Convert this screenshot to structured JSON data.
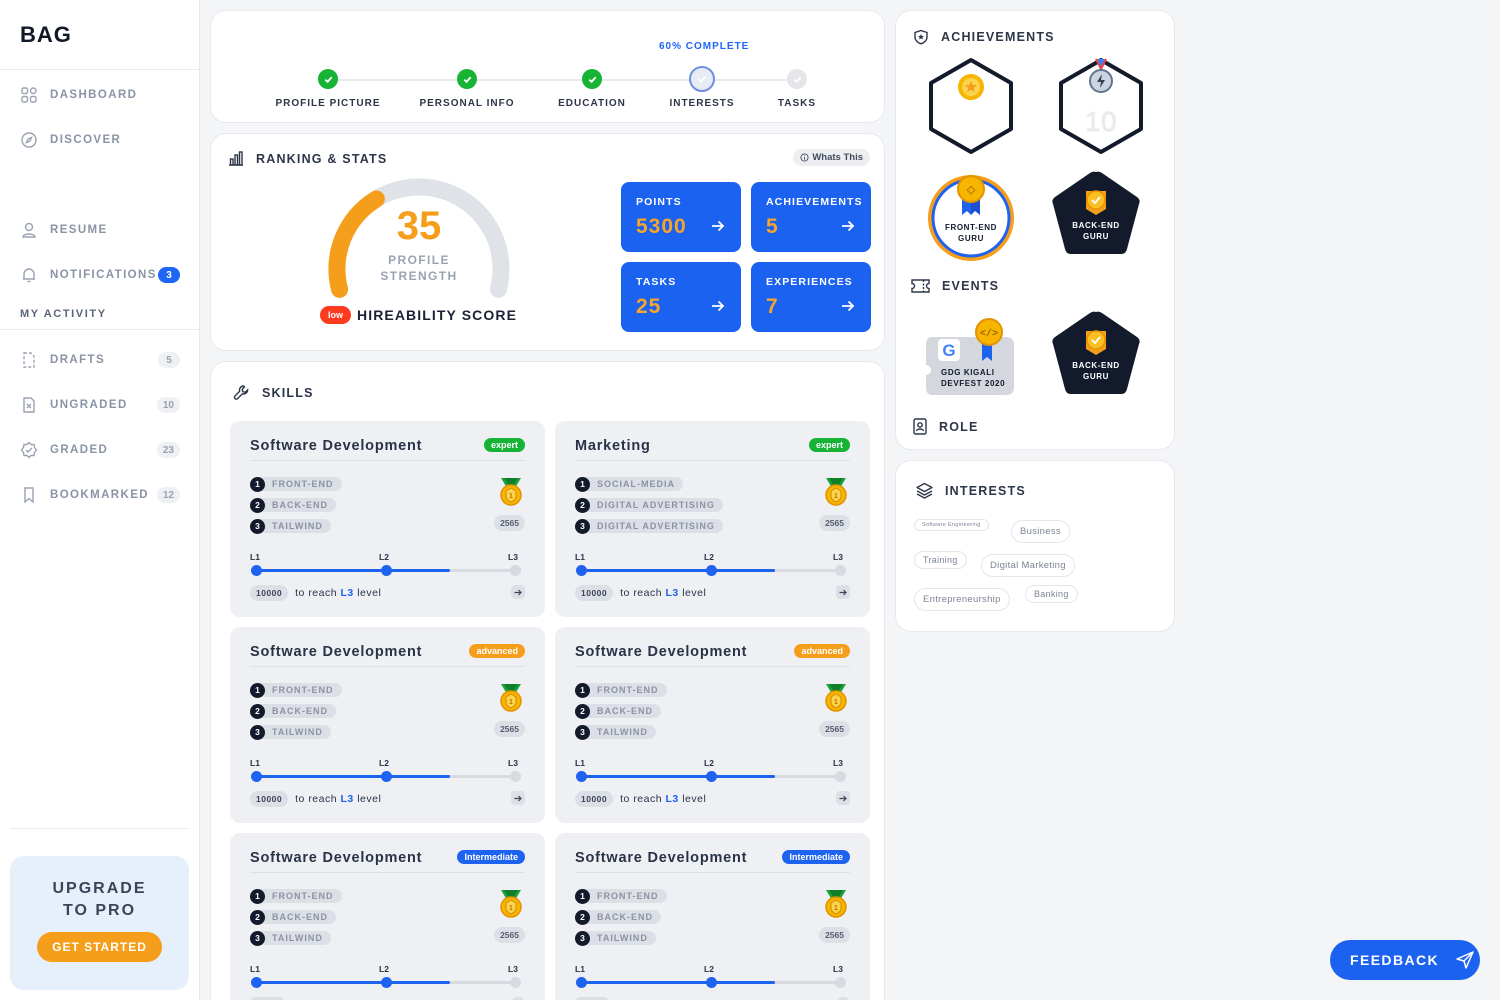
{
  "app": {
    "logo": "BAG"
  },
  "sidebar": {
    "items": [
      {
        "label": "DASHBOARD"
      },
      {
        "label": "DISCOVER"
      },
      {
        "label": "RESUME"
      },
      {
        "label": "NOTIFICATIONS",
        "count": "3"
      }
    ],
    "section_label": "MY ACTIVITY",
    "activity": [
      {
        "label": "DRAFTS",
        "count": "5"
      },
      {
        "label": "UNGRADED",
        "count": "10"
      },
      {
        "label": "GRADED",
        "count": "23"
      },
      {
        "label": "BOOKMARKED",
        "count": "12"
      }
    ],
    "upgrade": {
      "title_line1": "UPGRADE",
      "title_line2": "TO PRO",
      "button": "GET STARTED"
    }
  },
  "progress": {
    "label": "60% COMPLETE",
    "percent": 60,
    "steps": [
      {
        "label": "PROFILE PICTURE",
        "state": "done"
      },
      {
        "label": "PERSONAL INFO",
        "state": "done"
      },
      {
        "label": "EDUCATION",
        "state": "done"
      },
      {
        "label": "INTERESTS",
        "state": "current"
      },
      {
        "label": "TASKS",
        "state": "todo"
      }
    ]
  },
  "stats": {
    "title": "RANKING & STATS",
    "whats_this": "Whats This",
    "score": "35",
    "score_label_line1": "PROFILE",
    "score_label_line2": "STRENGTH",
    "gauge_fraction": 0.35,
    "hire_badge": "low",
    "hire_label": "HIREABILITY SCORE",
    "tiles": [
      {
        "label": "POINTS",
        "value": "5300"
      },
      {
        "label": "ACHIEVEMENTS",
        "value": "5"
      },
      {
        "label": "TASKS",
        "value": "25"
      },
      {
        "label": "EXPERIENCES",
        "value": "7"
      }
    ]
  },
  "skills": {
    "title": "SKILLS",
    "cards": [
      {
        "name": "Software Development",
        "level": "expert",
        "level_color": "#16b335",
        "items": [
          "FRONT-END",
          "BACK-END",
          "TAILWIND"
        ],
        "points": "2565",
        "levels": [
          "L1",
          "L2",
          "L3"
        ],
        "progress": 0.75,
        "reach_pts": "10000",
        "reach_text": "to reach",
        "reach_level": "L3",
        "reach_suffix": "level"
      },
      {
        "name": "Marketing",
        "level": "expert",
        "level_color": "#16b335",
        "items": [
          "SOCIAL-MEDIA",
          "DIGITAL ADVERTISING",
          "DIGITAL ADVERTISING"
        ],
        "points": "2565",
        "levels": [
          "L1",
          "L2",
          "L3"
        ],
        "progress": 0.75,
        "reach_pts": "10000",
        "reach_text": "to reach",
        "reach_level": "L3",
        "reach_suffix": "level"
      },
      {
        "name": "Software Development",
        "level": "advanced",
        "level_color": "#f59e1b",
        "items": [
          "FRONT-END",
          "BACK-END",
          "TAILWIND"
        ],
        "points": "2565",
        "levels": [
          "L1",
          "L2",
          "L3"
        ],
        "progress": 0.75,
        "reach_pts": "10000",
        "reach_text": "to reach",
        "reach_level": "L3",
        "reach_suffix": "level"
      },
      {
        "name": "Software Development",
        "level": "advanced",
        "level_color": "#f59e1b",
        "items": [
          "FRONT-END",
          "BACK-END",
          "TAILWIND"
        ],
        "points": "2565",
        "levels": [
          "L1",
          "L2",
          "L3"
        ],
        "progress": 0.75,
        "reach_pts": "10000",
        "reach_text": "to reach",
        "reach_level": "L3",
        "reach_suffix": "level"
      },
      {
        "name": "Software Development",
        "level": "Intermediate",
        "level_color": "#1e62f0",
        "items": [
          "FRONT-END",
          "BACK-END",
          "TAILWIND"
        ],
        "points": "2565",
        "levels": [
          "L1",
          "L2",
          "L3"
        ],
        "progress": 0.75,
        "reach_pts": "",
        "reach_text": "",
        "reach_level": "",
        "reach_suffix": ""
      },
      {
        "name": "Software Development",
        "level": "Intermediate",
        "level_color": "#1e62f0",
        "items": [
          "FRONT-END",
          "BACK-END",
          "TAILWIND"
        ],
        "points": "2565",
        "levels": [
          "L1",
          "L2",
          "L3"
        ],
        "progress": 0.75,
        "reach_pts": "",
        "reach_text": "",
        "reach_level": "",
        "reach_suffix": ""
      }
    ]
  },
  "achievements": {
    "title": "ACHIEVEMENTS",
    "badges": [
      {
        "label": ""
      },
      {
        "label": "10"
      },
      {
        "label_line1": "FRONT-END",
        "label_line2": "GURU"
      },
      {
        "label_line1": "BACK-END",
        "label_line2": "GURU"
      }
    ],
    "events_title": "EVENTS",
    "events": [
      {
        "label_line1": "GDG KIGALI",
        "label_line2": "DEVFEST 2020"
      },
      {
        "label_line1": "BACK-END",
        "label_line2": "GURU"
      }
    ],
    "role_title": "ROLE"
  },
  "interests": {
    "title": "INTERESTS",
    "tags": [
      "Software Engineering",
      "Business",
      "Training",
      "Digital Marketing",
      "Entrepreneurship",
      "Banking"
    ]
  },
  "feedback": {
    "label": "FEEDBACK"
  },
  "colors": {
    "primary": "#1c62f0",
    "accent": "#f59e1b",
    "success": "#16b335",
    "danger": "#ff3b1f",
    "navy": "#121a2c"
  }
}
